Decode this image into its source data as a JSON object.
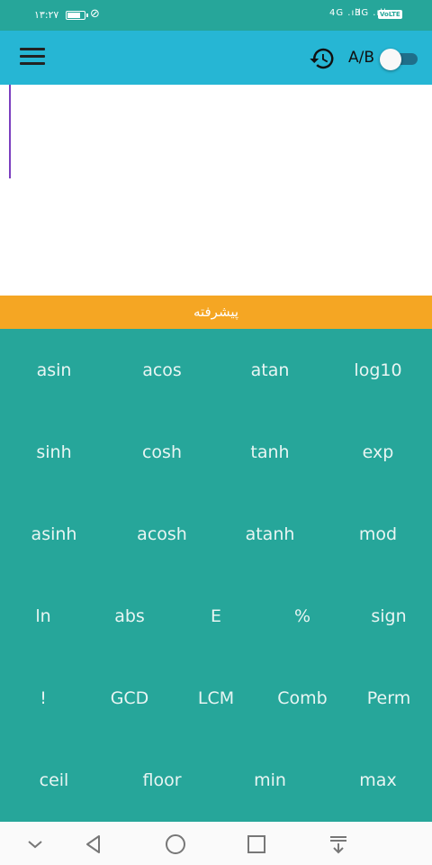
{
  "status_bar": {
    "time": "١٣:٢٧",
    "signal_1": "4G .ıll",
    "signal_2": "3G .ıll",
    "volte": "VoLTE"
  },
  "toolbar": {
    "mode_label": "A/B"
  },
  "tab": {
    "label": "پیشرفته"
  },
  "keypad": {
    "rows": [
      [
        "asin",
        "acos",
        "atan",
        "log10"
      ],
      [
        "sinh",
        "cosh",
        "tanh",
        "exp"
      ],
      [
        "asinh",
        "acosh",
        "atanh",
        "mod"
      ],
      [
        "ln",
        "abs",
        "E",
        "%",
        "sign"
      ],
      [
        "!",
        "GCD",
        "LCM",
        "Comb",
        "Perm"
      ],
      [
        "ceil",
        "floor",
        "min",
        "max"
      ]
    ]
  },
  "colors": {
    "toolbar": "#26b6d4",
    "keypad": "#26a69a",
    "tab": "#f5a623",
    "cursor": "#7b3fbf"
  }
}
